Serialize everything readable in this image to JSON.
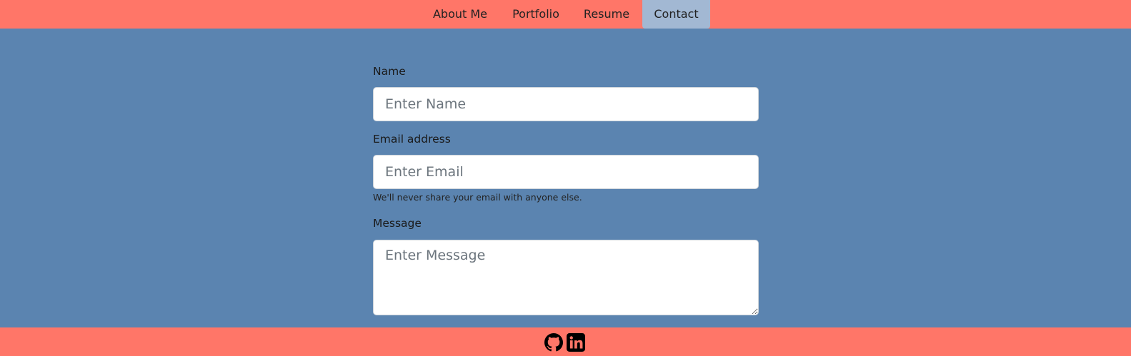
{
  "nav": {
    "items": [
      {
        "label": "About Me",
        "active": false
      },
      {
        "label": "Portfolio",
        "active": false
      },
      {
        "label": "Resume",
        "active": false
      },
      {
        "label": "Contact",
        "active": true
      }
    ]
  },
  "form": {
    "name": {
      "label": "Name",
      "placeholder": "Enter Name",
      "value": ""
    },
    "email": {
      "label": "Email address",
      "placeholder": "Enter Email",
      "value": "",
      "help": "We'll never share your email with anyone else."
    },
    "message": {
      "label": "Message",
      "placeholder": "Enter Message",
      "value": ""
    }
  },
  "footer": {
    "icons": [
      "github-icon",
      "linkedin-icon"
    ]
  },
  "colors": {
    "nav_bg": "#ff7668",
    "page_bg": "#5b84b0",
    "active_tab": "#a2b8d3"
  }
}
